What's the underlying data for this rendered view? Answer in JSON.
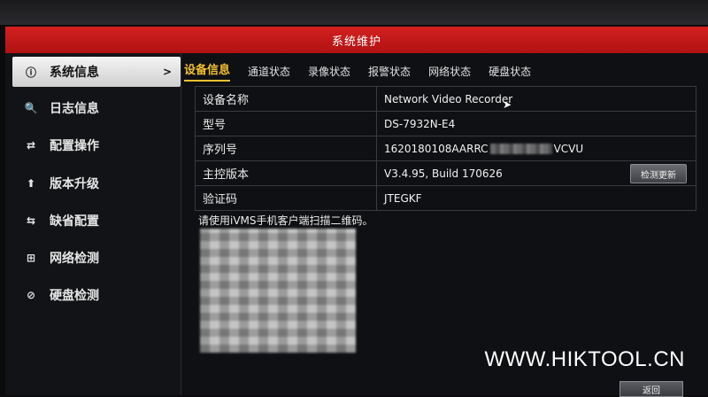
{
  "window": {
    "title": "系统维护"
  },
  "sidebar": {
    "items": [
      {
        "label": "系统信息",
        "icon": "info-icon",
        "active": true
      },
      {
        "label": "日志信息",
        "icon": "log-icon"
      },
      {
        "label": "配置操作",
        "icon": "config-icon"
      },
      {
        "label": "版本升级",
        "icon": "upgrade-arrow-icon"
      },
      {
        "label": "缺省配置",
        "icon": "restore-default-icon"
      },
      {
        "label": "网络检测",
        "icon": "network-icon"
      },
      {
        "label": "硬盘检测",
        "icon": "hdd-check-icon"
      }
    ],
    "active_chevron": ">"
  },
  "tabs": [
    {
      "label": "设备信息",
      "active": true
    },
    {
      "label": "通道状态"
    },
    {
      "label": "录像状态"
    },
    {
      "label": "报警状态"
    },
    {
      "label": "网络状态"
    },
    {
      "label": "硬盘状态"
    }
  ],
  "device": {
    "rows": [
      {
        "label": "设备名称",
        "value": "Network Video Recorder"
      },
      {
        "label": "型号",
        "value": "DS-7932N-E4"
      },
      {
        "label": "序列号",
        "value": "1620180108AARRC",
        "value_suffix": "VCVU"
      },
      {
        "label": "主控版本",
        "value": "V3.4.95, Build 170626"
      },
      {
        "label": "验证码",
        "value": "JTEGKF"
      }
    ],
    "check_update_label": "检测更新"
  },
  "qr": {
    "caption": "请使用iVMS手机客户端扫描二维码。"
  },
  "footer": {
    "back_label": "返回"
  },
  "watermark": "WWW.HIKTOOL.CN",
  "colors": {
    "titlebar": "#c41a1a",
    "active_tab": "#f0c030"
  }
}
